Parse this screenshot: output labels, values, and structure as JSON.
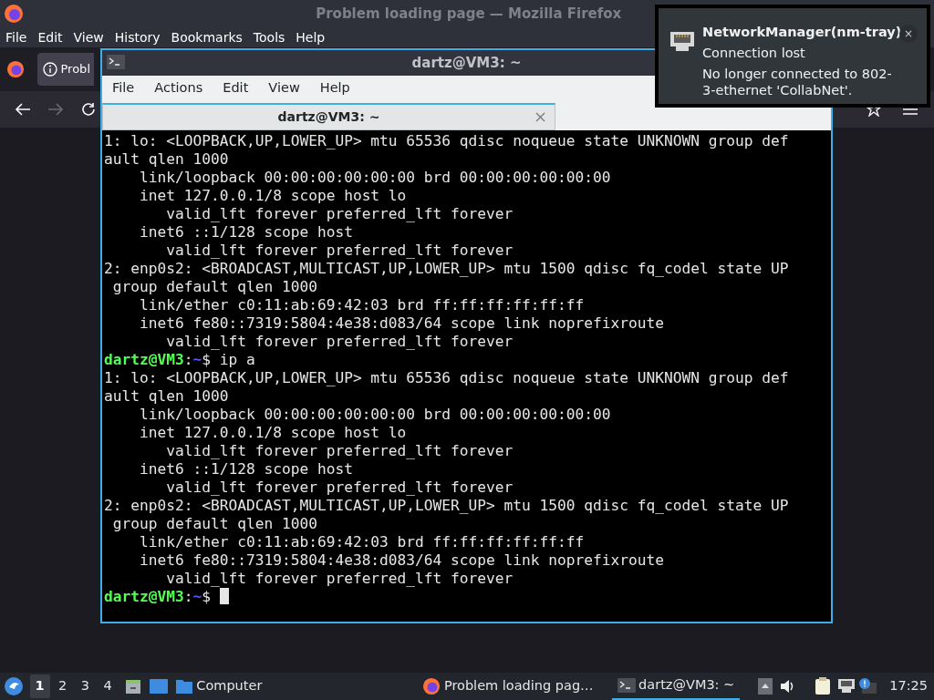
{
  "browser": {
    "title": "Problem loading page — Mozilla Firefox",
    "menu": [
      "File",
      "Edit",
      "View",
      "History",
      "Bookmarks",
      "Tools",
      "Help"
    ],
    "tab": {
      "label": "Probl"
    },
    "forward_disabled": true
  },
  "terminal": {
    "title": "dartz@VM3: ~",
    "menu": [
      "File",
      "Actions",
      "Edit",
      "View",
      "Help"
    ],
    "tab": {
      "label": "dartz@VM3: ~",
      "selected": true
    },
    "lines": [
      {
        "kind": "output",
        "text": "1: lo: <LOOPBACK,UP,LOWER_UP> mtu 65536 qdisc noqueue state UNKNOWN group def"
      },
      {
        "kind": "output",
        "text": "ault qlen 1000"
      },
      {
        "kind": "output",
        "text": "    link/loopback 00:00:00:00:00:00 brd 00:00:00:00:00:00"
      },
      {
        "kind": "output",
        "text": "    inet 127.0.0.1/8 scope host lo"
      },
      {
        "kind": "output",
        "text": "       valid_lft forever preferred_lft forever"
      },
      {
        "kind": "output",
        "text": "    inet6 ::1/128 scope host"
      },
      {
        "kind": "output",
        "text": "       valid_lft forever preferred_lft forever"
      },
      {
        "kind": "output",
        "text": "2: enp0s2: <BROADCAST,MULTICAST,UP,LOWER_UP> mtu 1500 qdisc fq_codel state UP"
      },
      {
        "kind": "output",
        "text": " group default qlen 1000"
      },
      {
        "kind": "output",
        "text": "    link/ether c0:11:ab:69:42:03 brd ff:ff:ff:ff:ff:ff"
      },
      {
        "kind": "output",
        "text": "    inet6 fe80::7319:5804:4e38:d083/64 scope link noprefixroute"
      },
      {
        "kind": "output",
        "text": "       valid_lft forever preferred_lft forever"
      },
      {
        "kind": "prompt",
        "user": "dartz@VM3",
        "sep": ":",
        "path": "~",
        "symbol": "$",
        "command": " ip a",
        "cursor": false
      },
      {
        "kind": "output",
        "text": "1: lo: <LOOPBACK,UP,LOWER_UP> mtu 65536 qdisc noqueue state UNKNOWN group def"
      },
      {
        "kind": "output",
        "text": "ault qlen 1000"
      },
      {
        "kind": "output",
        "text": "    link/loopback 00:00:00:00:00:00 brd 00:00:00:00:00:00"
      },
      {
        "kind": "output",
        "text": "    inet 127.0.0.1/8 scope host lo"
      },
      {
        "kind": "output",
        "text": "       valid_lft forever preferred_lft forever"
      },
      {
        "kind": "output",
        "text": "    inet6 ::1/128 scope host"
      },
      {
        "kind": "output",
        "text": "       valid_lft forever preferred_lft forever"
      },
      {
        "kind": "output",
        "text": "2: enp0s2: <BROADCAST,MULTICAST,UP,LOWER_UP> mtu 1500 qdisc fq_codel state UP"
      },
      {
        "kind": "output",
        "text": " group default qlen 1000"
      },
      {
        "kind": "output",
        "text": "    link/ether c0:11:ab:69:42:03 brd ff:ff:ff:ff:ff:ff"
      },
      {
        "kind": "output",
        "text": "    inet6 fe80::7319:5804:4e38:d083/64 scope link noprefixroute"
      },
      {
        "kind": "output",
        "text": "       valid_lft forever preferred_lft forever"
      },
      {
        "kind": "prompt",
        "user": "dartz@VM3",
        "sep": ":",
        "path": "~",
        "symbol": "$",
        "cursor": true
      }
    ]
  },
  "notification": {
    "app": "NetworkManager(nm-tray)",
    "summary": "Connection lost",
    "body": "No longer connected to 802-3-ethernet 'CollabNet'.",
    "close": "×"
  },
  "taskbar": {
    "workspaces": [
      {
        "label": "1",
        "selected": true
      },
      {
        "label": "2",
        "selected": false
      },
      {
        "label": "3",
        "selected": false
      },
      {
        "label": "4",
        "selected": false
      }
    ],
    "places": [
      {
        "label": "Computer"
      }
    ],
    "tasks": [
      {
        "kind": "browser",
        "label": "Problem loading pag…",
        "selected": false
      },
      {
        "kind": "terminal",
        "label": "dartz@VM3: ~",
        "selected": true
      }
    ],
    "clock": "17:25"
  }
}
